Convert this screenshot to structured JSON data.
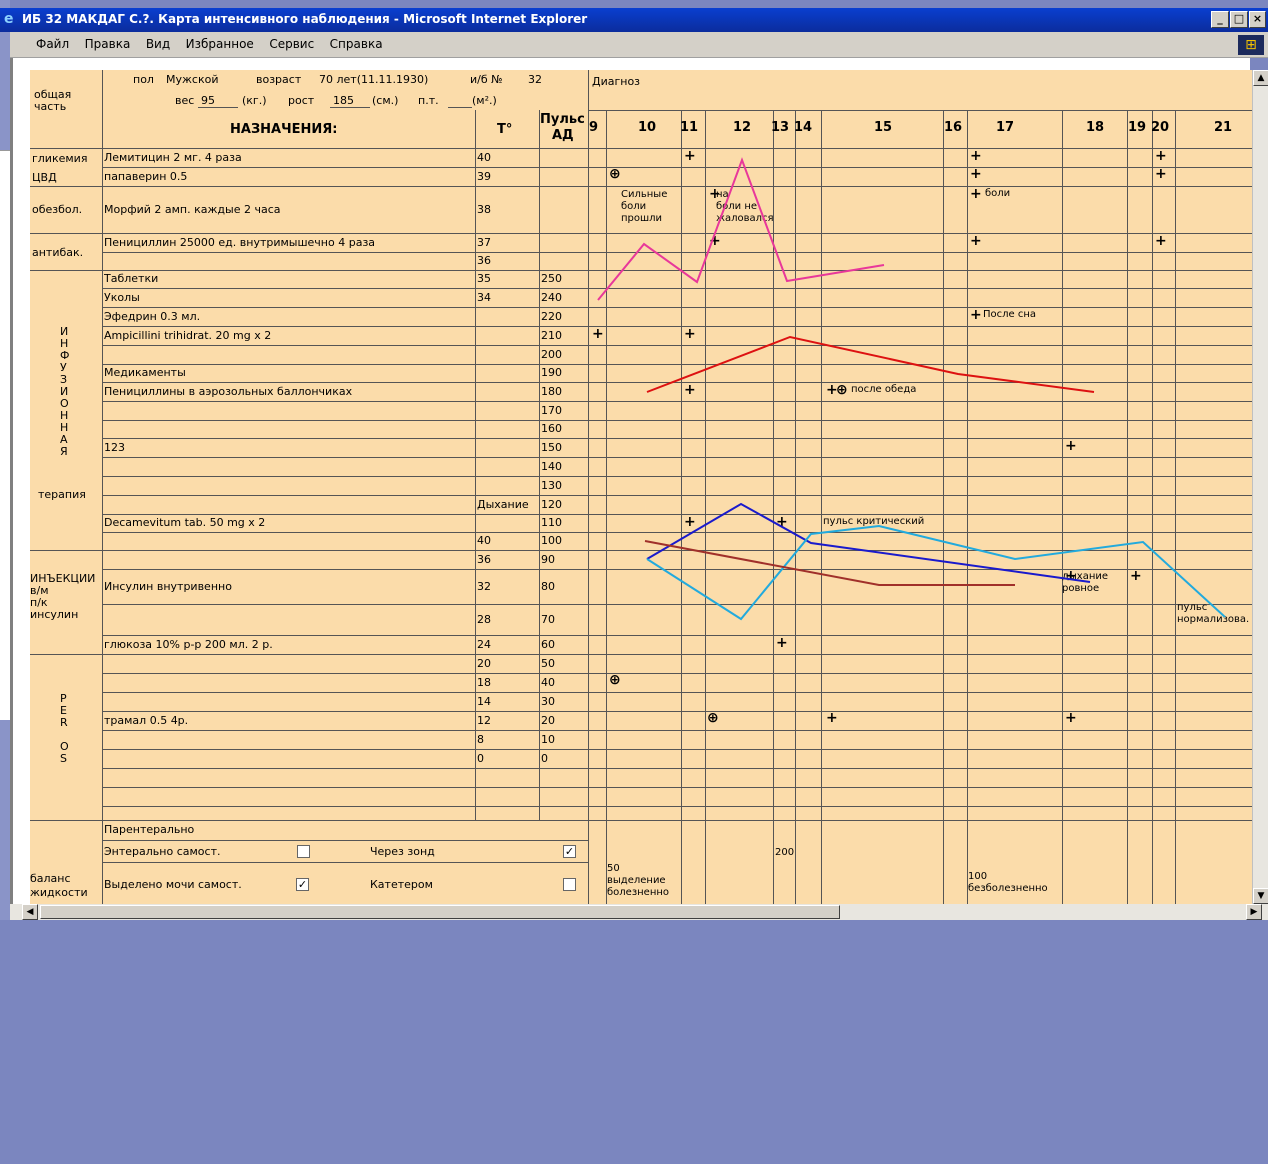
{
  "window": {
    "title": "ИБ 32 МАКДАГ С.?. Карта интенсивного наблюдения - Microsoft Internet Explorer",
    "min": "_",
    "max": "□",
    "close": "×"
  },
  "menu": [
    "Файл",
    "Правка",
    "Вид",
    "Избранное",
    "Сервис",
    "Справка"
  ],
  "patient": {
    "general_label_1": "общая",
    "general_label_2": "часть",
    "line1_k1": "пол",
    "sex": "Мужской",
    "line1_k2": "возраст",
    "age": "70 лет(11.11.1930)",
    "line1_k3": "и/б №",
    "record_no": "32",
    "line2_k1": "вес",
    "weight": "95",
    "weight_unit": "(кг.)",
    "line2_k2": "рост",
    "height": "185",
    "height_unit": "(см.)",
    "line2_k3": "п.т.",
    "bsa": "",
    "bsa_unit": "(м².)",
    "diagnosis_label": "Диагноз"
  },
  "headers": {
    "prescriptions": "НАЗНАЧЕНИЯ:",
    "temp": "Т°",
    "pulse1": "Пульс",
    "pulse2": "АД"
  },
  "hours": [
    "9",
    "10",
    "11",
    "12",
    "13",
    "14",
    "15",
    "16",
    "17",
    "18",
    "19",
    "20",
    "21"
  ],
  "sections": {
    "glycemia": "гликемия",
    "cvd": "ЦВД",
    "analgesia": "обезбол.",
    "antibac": "антибак.",
    "infusion_letters": [
      "И",
      "Н",
      "Ф",
      "У",
      "З",
      "И",
      "О",
      "Н",
      "Н",
      "А",
      "Я"
    ],
    "infusion_word": "терапия",
    "injections": [
      "ИНЪЕКЦИИ",
      "в/м",
      "п/к",
      "инсулин"
    ],
    "peros": [
      "P",
      "E",
      "R",
      "",
      "O",
      "S"
    ],
    "balance": [
      "баланс",
      "жидкости"
    ]
  },
  "rows": [
    {
      "name": "Лемитицин 2 мг. 4 раза",
      "t": "40",
      "p": ""
    },
    {
      "name": "папаверин 0.5",
      "t": "39",
      "p": ""
    },
    {
      "name": "Морфий 2 амп. каждые 2 часа",
      "t": "38",
      "p": ""
    },
    {
      "name": "Пенициллин 25000 ед. внутримышечно 4 раза",
      "t": "37",
      "p": ""
    },
    {
      "name": "",
      "t": "36",
      "p": ""
    },
    {
      "name": "Таблетки",
      "t": "35",
      "p": "250"
    },
    {
      "name": "Уколы",
      "t": "34",
      "p": "240"
    },
    {
      "name": "Эфедрин 0.3 мл.",
      "t": "",
      "p": "220"
    },
    {
      "name": "Ampicillini trihidrat. 20 mg x 2",
      "t": "",
      "p": "210"
    },
    {
      "name": "",
      "t": "",
      "p": "200"
    },
    {
      "name": "Медикаменты",
      "t": "",
      "p": "190"
    },
    {
      "name": "Пенициллины в аэрозольных баллончиках",
      "t": "",
      "p": "180"
    },
    {
      "name": "",
      "t": "",
      "p": "170"
    },
    {
      "name": "",
      "t": "",
      "p": "160"
    },
    {
      "name": "123",
      "t": "",
      "p": "150"
    },
    {
      "name": "",
      "t": "",
      "p": "140"
    },
    {
      "name": "",
      "t": "",
      "p": "130"
    },
    {
      "name": "",
      "t": "Дыхание",
      "p": "120"
    },
    {
      "name": "Decamevitum tab. 50 mg x 2",
      "t": "",
      "p": "110"
    },
    {
      "name": "",
      "t": "40",
      "p": "100"
    },
    {
      "name": "",
      "t": "36",
      "p": "90"
    },
    {
      "name": "Инсулин внутривенно",
      "t": "32",
      "p": "80"
    },
    {
      "name": "",
      "t": "28",
      "p": "70"
    },
    {
      "name": "глюкоза 10% р-р 200 мл. 2 р.",
      "t": "24",
      "p": "60"
    },
    {
      "name": "",
      "t": "20",
      "p": "50"
    },
    {
      "name": "",
      "t": "18",
      "p": "40"
    },
    {
      "name": "",
      "t": "14",
      "p": "30"
    },
    {
      "name": "трамал 0.5 4р.",
      "t": "12",
      "p": "20"
    },
    {
      "name": "",
      "t": "8",
      "p": "10"
    },
    {
      "name": "",
      "t": "0",
      "p": "0"
    }
  ],
  "notes": {
    "n_pain_gone": "Сильные\nболи\nпрошли",
    "n_no_complaint": "на\nболи не\nжаловался",
    "n_pain": "боли",
    "n_after_sleep": "После сна",
    "n_after_lunch": "после обеда",
    "n_pulse_critical": "пульс критический",
    "n_breath_even": "дыхание\nровное",
    "n_pulse_norm": "пульс\nнормализова.",
    "n_200": "200",
    "n_50": "50\nвыделение\nболезненно",
    "n_100": "100\nбезболезненно"
  },
  "balance": {
    "parenteral": "Парентерально",
    "enteral": "Энтерально самост.",
    "tube": "Через зонд",
    "urine": "Выделено мочи самост.",
    "catheter": "Катетером"
  },
  "colors": {
    "grid_bg": "#fbdcaa",
    "titlebar": "#0a3fd0",
    "temp_line": "#e8389a",
    "pulse_line": "#dd1111",
    "blue_line": "#1a1acc",
    "cyan_line": "#22aadd",
    "brown_line": "#a0302a"
  }
}
